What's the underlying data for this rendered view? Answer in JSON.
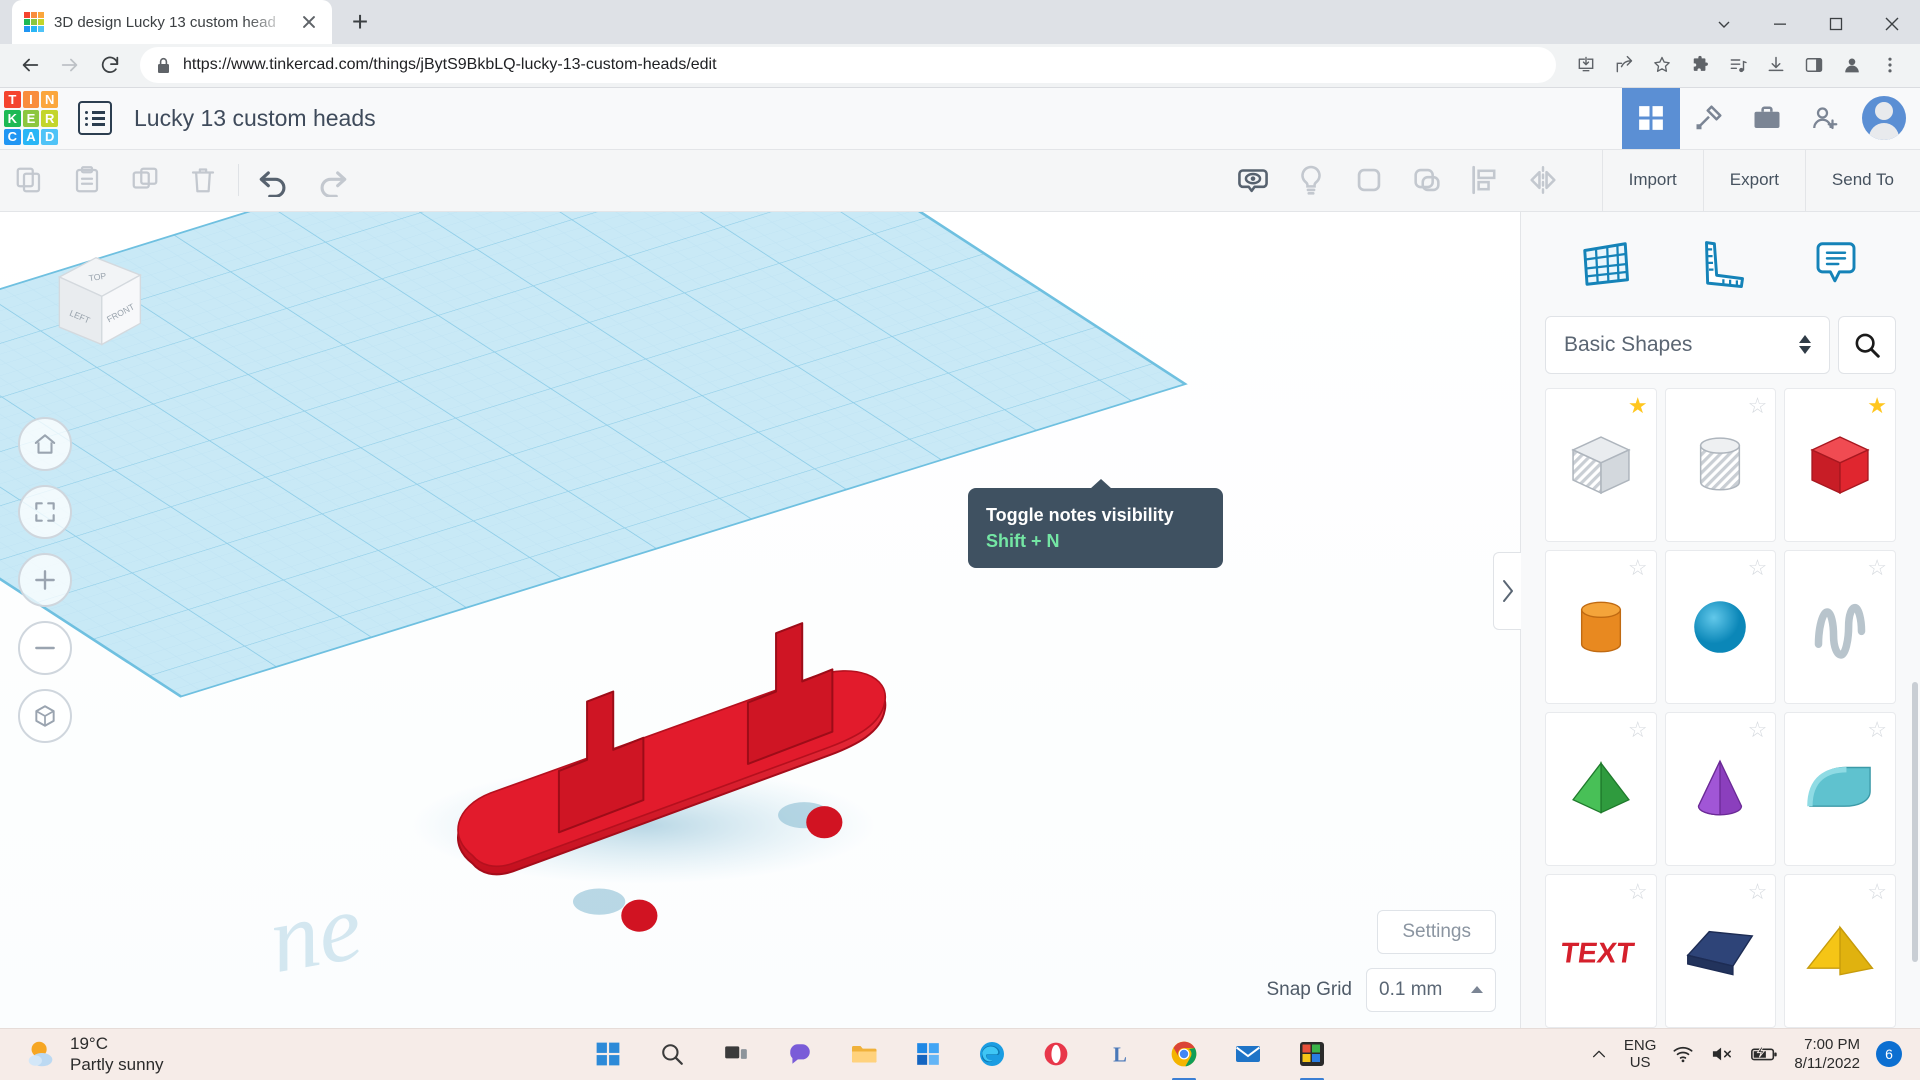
{
  "browser": {
    "tab": {
      "title": "3D design Lucky 13 custom head",
      "favicon": "tinkercad-favicon",
      "close_label": "Close tab"
    },
    "new_tab_label": "New Tab",
    "url": "https://www.tinkercad.com/things/jBytS9BkbLQ-lucky-13-custom-heads/edit",
    "lock_icon": "lock-icon",
    "nav": {
      "back": "back-icon",
      "forward": "forward-icon",
      "reload": "reload-icon"
    },
    "toolbar_icons": [
      "install-icon",
      "share-icon",
      "bookmark-star-icon",
      "extensions-puzzle-icon",
      "media-control-icon",
      "downloads-icon",
      "side-panel-icon",
      "profile-icon",
      "chrome-menu-icon"
    ],
    "window_controls": [
      "minimize-group-icon",
      "minimize-icon",
      "maximize-icon",
      "close-icon"
    ]
  },
  "app": {
    "logo_letters": [
      "T",
      "I",
      "N",
      "K",
      "E",
      "R",
      "C",
      "A",
      "D"
    ],
    "logo_colors": [
      "#f4442e",
      "#f98d3d",
      "#fba63c",
      "#1db954",
      "#8cc63f",
      "#c3d52b",
      "#2196f3",
      "#29b6f6",
      "#4fc3f7"
    ],
    "title": "Lucky 13 custom heads",
    "menu_button": "grid-menu-icon",
    "header_icons": [
      {
        "name": "gallery-grid-icon",
        "active": true
      },
      {
        "name": "codeblocks-pickaxe-icon",
        "active": false
      },
      {
        "name": "classes-briefcase-icon",
        "active": false
      },
      {
        "name": "invite-person-icon",
        "active": false
      }
    ],
    "avatar": "user-avatar"
  },
  "toolbar": {
    "left_tools": [
      {
        "name": "copy-icon",
        "enabled": false
      },
      {
        "name": "paste-icon",
        "enabled": false
      },
      {
        "name": "duplicate-icon",
        "enabled": false
      },
      {
        "name": "delete-trash-icon",
        "enabled": false
      }
    ],
    "history_tools": [
      {
        "name": "undo-icon",
        "enabled": true
      },
      {
        "name": "redo-icon",
        "enabled": false
      }
    ],
    "center_tools": [
      {
        "name": "toggle-notes-visibility-icon",
        "enabled": true
      },
      {
        "name": "hide-light-bulb-icon",
        "enabled": false
      },
      {
        "name": "group-shapes-icon",
        "enabled": false
      },
      {
        "name": "ungroup-shapes-icon",
        "enabled": false
      },
      {
        "name": "align-icon",
        "enabled": false
      },
      {
        "name": "mirror-flip-icon",
        "enabled": false
      }
    ],
    "import_label": "Import",
    "export_label": "Export",
    "send_to_label": "Send To"
  },
  "tooltip": {
    "title": "Toggle notes visibility",
    "shortcut": "Shift + N",
    "title_color": "#ffffff",
    "shortcut_color": "#74e6a4",
    "background": "#3f5161"
  },
  "canvas": {
    "viewcube": {
      "top_label": "TOP",
      "left_label": "LEFT",
      "front_label": "FRONT"
    },
    "nav_tools": [
      {
        "name": "home-view-icon"
      },
      {
        "name": "fit-to-view-icon"
      },
      {
        "name": "zoom-in-icon"
      },
      {
        "name": "zoom-out-icon"
      },
      {
        "name": "orthographic-view-icon"
      }
    ],
    "watermark": "ne",
    "model": {
      "name": "red-skateboard",
      "color": "#e21b2c"
    },
    "workplane_color": "#a5d8ee"
  },
  "canvas_controls": {
    "settings_label": "Settings",
    "snap_grid_label": "Snap Grid",
    "snap_grid_value": "0.1 mm",
    "snap_caret": "caret-up-icon"
  },
  "panel": {
    "collapse_icon": "chevron-right-icon",
    "tools": [
      {
        "name": "workplane-icon"
      },
      {
        "name": "ruler-icon"
      },
      {
        "name": "note-icon"
      }
    ],
    "shape_category": "Basic Shapes",
    "search_icon": "search-icon",
    "shapes": [
      {
        "name": "box-shape",
        "starred": true
      },
      {
        "name": "cylinder-shape",
        "starred": false
      },
      {
        "name": "red-box-shape",
        "starred": true
      },
      {
        "name": "orange-cylinder-shape",
        "starred": false
      },
      {
        "name": "blue-sphere-shape",
        "starred": false
      },
      {
        "name": "scribble-shape",
        "starred": false
      },
      {
        "name": "green-pyramid-shape",
        "starred": false
      },
      {
        "name": "purple-cone-shape",
        "starred": false
      },
      {
        "name": "teal-roof-shape",
        "starred": false
      },
      {
        "name": "red-text-shape",
        "starred": false
      },
      {
        "name": "navy-wedge-shape",
        "starred": false
      },
      {
        "name": "yellow-polygon-shape",
        "starred": false
      }
    ]
  },
  "taskbar": {
    "weather": {
      "temperature": "19°C",
      "condition": "Partly sunny",
      "icon": "partly-sunny-icon"
    },
    "apps": [
      {
        "name": "start-windows-icon",
        "active": false
      },
      {
        "name": "search-icon",
        "active": false
      },
      {
        "name": "task-view-icon",
        "active": false
      },
      {
        "name": "chat-teams-icon",
        "active": false
      },
      {
        "name": "file-explorer-icon",
        "active": false
      },
      {
        "name": "microsoft-store-icon",
        "active": false
      },
      {
        "name": "edge-browser-icon",
        "active": false
      },
      {
        "name": "opera-browser-icon",
        "active": false
      },
      {
        "name": "lightshot-icon",
        "active": false
      },
      {
        "name": "chrome-browser-icon",
        "active": true
      },
      {
        "name": "mail-icon",
        "active": false
      },
      {
        "name": "photos-icon",
        "active": true
      }
    ],
    "tray": {
      "overflow_icon": "chevron-up-icon",
      "language_line1": "ENG",
      "language_line2": "US",
      "wifi_icon": "wifi-icon",
      "volume_icon": "volume-muted-icon",
      "battery_icon": "battery-charging-icon",
      "time": "7:00 PM",
      "date": "8/11/2022",
      "notification_count": "6"
    }
  }
}
